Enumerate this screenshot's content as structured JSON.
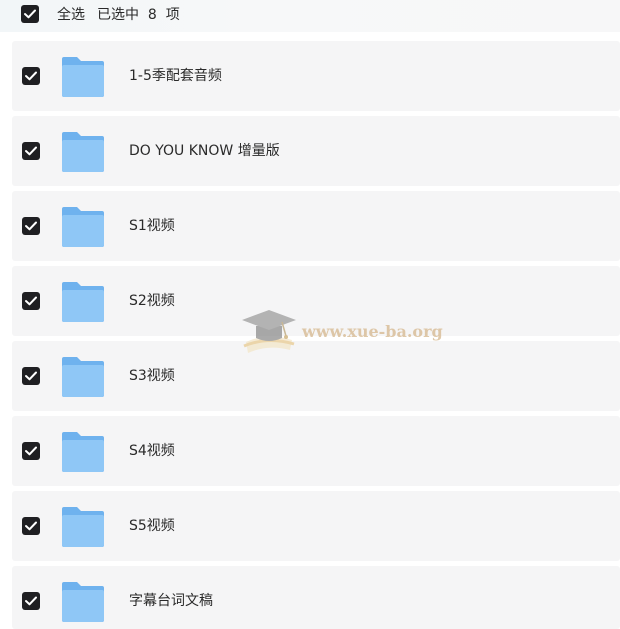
{
  "header": {
    "select_all": "全选",
    "selected_count": "已选中  8  项"
  },
  "folders": [
    {
      "name": "1-5季配套音频",
      "checked": true
    },
    {
      "name": "DO YOU KNOW 增量版",
      "checked": true
    },
    {
      "name": "S1视频",
      "checked": true
    },
    {
      "name": "S2视频",
      "checked": true
    },
    {
      "name": "S3视频",
      "checked": true
    },
    {
      "name": "S4视频",
      "checked": true
    },
    {
      "name": "S5视频",
      "checked": true
    },
    {
      "name": "字幕台词文稿",
      "checked": true
    }
  ],
  "watermark": {
    "text": "www.xue-ba.org"
  },
  "colors": {
    "checkbox": "#1f1f22",
    "row_background": "#f5f5f6",
    "folder_back": "#6fb2ee",
    "folder_front": "#8fc7f6"
  }
}
